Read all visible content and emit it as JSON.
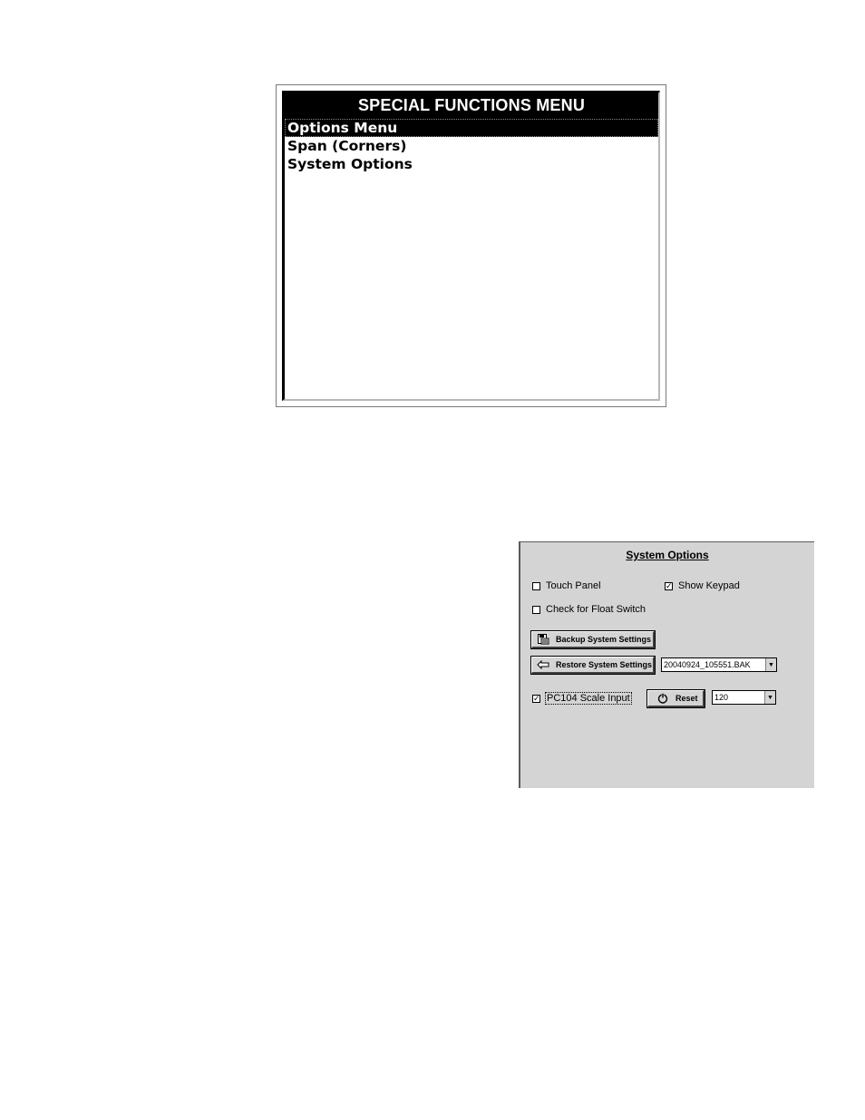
{
  "special_functions_menu": {
    "title": "SPECIAL FUNCTIONS MENU",
    "items": [
      {
        "label": "Options Menu",
        "selected": true
      },
      {
        "label": "Span (Corners)",
        "selected": false
      },
      {
        "label": "System Options",
        "selected": false
      }
    ]
  },
  "system_options": {
    "title": "System Options",
    "touch_panel": {
      "label": "Touch Panel",
      "checked": false
    },
    "show_keypad": {
      "label": "Show Keypad",
      "checked": true
    },
    "float_switch": {
      "label": "Check for Float Switch",
      "checked": false
    },
    "backup_button": {
      "label": "Backup System Settings",
      "icon": "floppy-disk-icon"
    },
    "restore_button": {
      "label": "Restore System Settings",
      "icon": "restore-arrow-icon"
    },
    "restore_file": {
      "value": "20040924_105551.BAK"
    },
    "pc104": {
      "label": "PC104 Scale Input",
      "checked": true
    },
    "reset_button": {
      "label": "Reset",
      "icon": "power-icon"
    },
    "scale_value": {
      "value": "120"
    },
    "check_mark": "✓",
    "dropdown_arrow": "▼"
  }
}
